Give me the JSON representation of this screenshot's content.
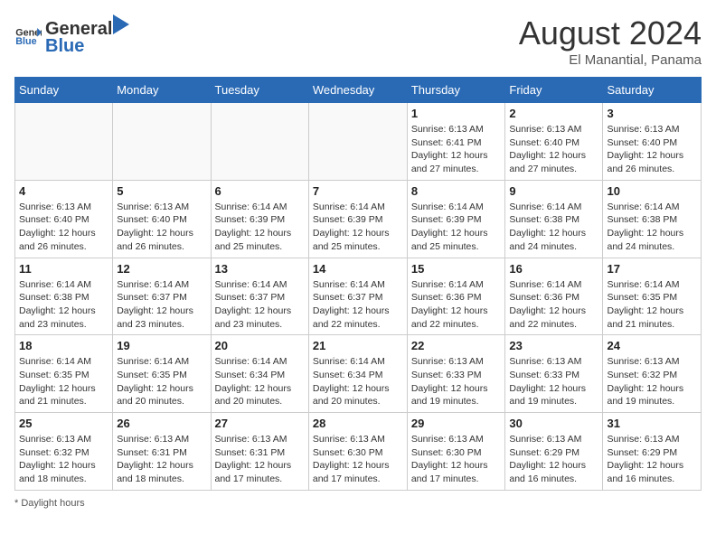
{
  "header": {
    "logo_general": "General",
    "logo_blue": "Blue",
    "month_title": "August 2024",
    "subtitle": "El Manantial, Panama"
  },
  "days_of_week": [
    "Sunday",
    "Monday",
    "Tuesday",
    "Wednesday",
    "Thursday",
    "Friday",
    "Saturday"
  ],
  "weeks": [
    [
      {
        "day": "",
        "info": ""
      },
      {
        "day": "",
        "info": ""
      },
      {
        "day": "",
        "info": ""
      },
      {
        "day": "",
        "info": ""
      },
      {
        "day": "1",
        "info": "Sunrise: 6:13 AM\nSunset: 6:41 PM\nDaylight: 12 hours and 27 minutes."
      },
      {
        "day": "2",
        "info": "Sunrise: 6:13 AM\nSunset: 6:40 PM\nDaylight: 12 hours and 27 minutes."
      },
      {
        "day": "3",
        "info": "Sunrise: 6:13 AM\nSunset: 6:40 PM\nDaylight: 12 hours and 26 minutes."
      }
    ],
    [
      {
        "day": "4",
        "info": "Sunrise: 6:13 AM\nSunset: 6:40 PM\nDaylight: 12 hours and 26 minutes."
      },
      {
        "day": "5",
        "info": "Sunrise: 6:13 AM\nSunset: 6:40 PM\nDaylight: 12 hours and 26 minutes."
      },
      {
        "day": "6",
        "info": "Sunrise: 6:14 AM\nSunset: 6:39 PM\nDaylight: 12 hours and 25 minutes."
      },
      {
        "day": "7",
        "info": "Sunrise: 6:14 AM\nSunset: 6:39 PM\nDaylight: 12 hours and 25 minutes."
      },
      {
        "day": "8",
        "info": "Sunrise: 6:14 AM\nSunset: 6:39 PM\nDaylight: 12 hours and 25 minutes."
      },
      {
        "day": "9",
        "info": "Sunrise: 6:14 AM\nSunset: 6:38 PM\nDaylight: 12 hours and 24 minutes."
      },
      {
        "day": "10",
        "info": "Sunrise: 6:14 AM\nSunset: 6:38 PM\nDaylight: 12 hours and 24 minutes."
      }
    ],
    [
      {
        "day": "11",
        "info": "Sunrise: 6:14 AM\nSunset: 6:38 PM\nDaylight: 12 hours and 23 minutes."
      },
      {
        "day": "12",
        "info": "Sunrise: 6:14 AM\nSunset: 6:37 PM\nDaylight: 12 hours and 23 minutes."
      },
      {
        "day": "13",
        "info": "Sunrise: 6:14 AM\nSunset: 6:37 PM\nDaylight: 12 hours and 23 minutes."
      },
      {
        "day": "14",
        "info": "Sunrise: 6:14 AM\nSunset: 6:37 PM\nDaylight: 12 hours and 22 minutes."
      },
      {
        "day": "15",
        "info": "Sunrise: 6:14 AM\nSunset: 6:36 PM\nDaylight: 12 hours and 22 minutes."
      },
      {
        "day": "16",
        "info": "Sunrise: 6:14 AM\nSunset: 6:36 PM\nDaylight: 12 hours and 22 minutes."
      },
      {
        "day": "17",
        "info": "Sunrise: 6:14 AM\nSunset: 6:35 PM\nDaylight: 12 hours and 21 minutes."
      }
    ],
    [
      {
        "day": "18",
        "info": "Sunrise: 6:14 AM\nSunset: 6:35 PM\nDaylight: 12 hours and 21 minutes."
      },
      {
        "day": "19",
        "info": "Sunrise: 6:14 AM\nSunset: 6:35 PM\nDaylight: 12 hours and 20 minutes."
      },
      {
        "day": "20",
        "info": "Sunrise: 6:14 AM\nSunset: 6:34 PM\nDaylight: 12 hours and 20 minutes."
      },
      {
        "day": "21",
        "info": "Sunrise: 6:14 AM\nSunset: 6:34 PM\nDaylight: 12 hours and 20 minutes."
      },
      {
        "day": "22",
        "info": "Sunrise: 6:13 AM\nSunset: 6:33 PM\nDaylight: 12 hours and 19 minutes."
      },
      {
        "day": "23",
        "info": "Sunrise: 6:13 AM\nSunset: 6:33 PM\nDaylight: 12 hours and 19 minutes."
      },
      {
        "day": "24",
        "info": "Sunrise: 6:13 AM\nSunset: 6:32 PM\nDaylight: 12 hours and 19 minutes."
      }
    ],
    [
      {
        "day": "25",
        "info": "Sunrise: 6:13 AM\nSunset: 6:32 PM\nDaylight: 12 hours and 18 minutes."
      },
      {
        "day": "26",
        "info": "Sunrise: 6:13 AM\nSunset: 6:31 PM\nDaylight: 12 hours and 18 minutes."
      },
      {
        "day": "27",
        "info": "Sunrise: 6:13 AM\nSunset: 6:31 PM\nDaylight: 12 hours and 17 minutes."
      },
      {
        "day": "28",
        "info": "Sunrise: 6:13 AM\nSunset: 6:30 PM\nDaylight: 12 hours and 17 minutes."
      },
      {
        "day": "29",
        "info": "Sunrise: 6:13 AM\nSunset: 6:30 PM\nDaylight: 12 hours and 17 minutes."
      },
      {
        "day": "30",
        "info": "Sunrise: 6:13 AM\nSunset: 6:29 PM\nDaylight: 12 hours and 16 minutes."
      },
      {
        "day": "31",
        "info": "Sunrise: 6:13 AM\nSunset: 6:29 PM\nDaylight: 12 hours and 16 minutes."
      }
    ]
  ],
  "footer": "* Daylight hours"
}
